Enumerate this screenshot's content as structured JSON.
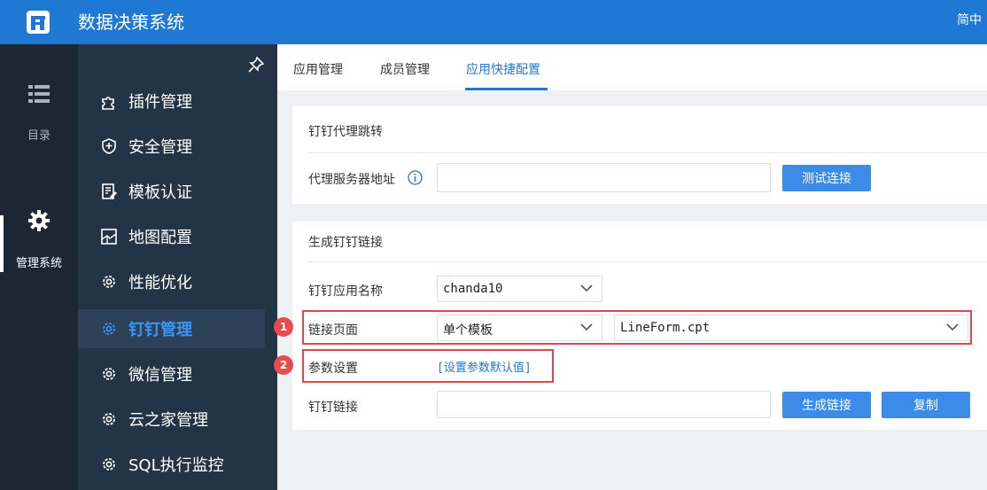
{
  "header": {
    "app_title": "数据决策系统",
    "lang_label": "简中"
  },
  "rail": {
    "items": [
      {
        "label": "目录",
        "icon": "list-icon"
      },
      {
        "label": "管理系统",
        "icon": "gear-icon"
      }
    ]
  },
  "nav": {
    "items": [
      {
        "label": "插件管理",
        "icon": "plugin-icon"
      },
      {
        "label": "安全管理",
        "icon": "shield-icon"
      },
      {
        "label": "模板认证",
        "icon": "template-icon"
      },
      {
        "label": "地图配置",
        "icon": "map-icon"
      },
      {
        "label": "性能优化",
        "icon": "gear-icon"
      },
      {
        "label": "钉钉管理",
        "icon": "gear-icon"
      },
      {
        "label": "微信管理",
        "icon": "gear-icon"
      },
      {
        "label": "云之家管理",
        "icon": "gear-icon"
      },
      {
        "label": "SQL执行监控",
        "icon": "gear-icon"
      }
    ],
    "active_index": 5
  },
  "tabs": [
    {
      "label": "应用管理"
    },
    {
      "label": "成员管理"
    },
    {
      "label": "应用快捷配置"
    }
  ],
  "proxy_section": {
    "title": "钉钉代理跳转",
    "server_label": "代理服务器地址",
    "server_value": "",
    "test_button": "测试连接"
  },
  "link_section": {
    "title": "生成钉钉链接",
    "app_name_label": "钉钉应用名称",
    "app_name_value": "chanda10",
    "page_label": "链接页面",
    "page_type_value": "单个模板",
    "page_file_value": "LineForm.cpt",
    "param_label": "参数设置",
    "param_link": "[设置参数默认值]",
    "dd_link_label": "钉钉链接",
    "dd_link_value": "",
    "generate_button": "生成链接",
    "copy_button": "复制"
  },
  "annotations": {
    "badge1": "1",
    "badge2": "2"
  },
  "colors": {
    "brand": "#1e78d4",
    "button": "#3c8ce7",
    "highlight": "#e0474c"
  }
}
